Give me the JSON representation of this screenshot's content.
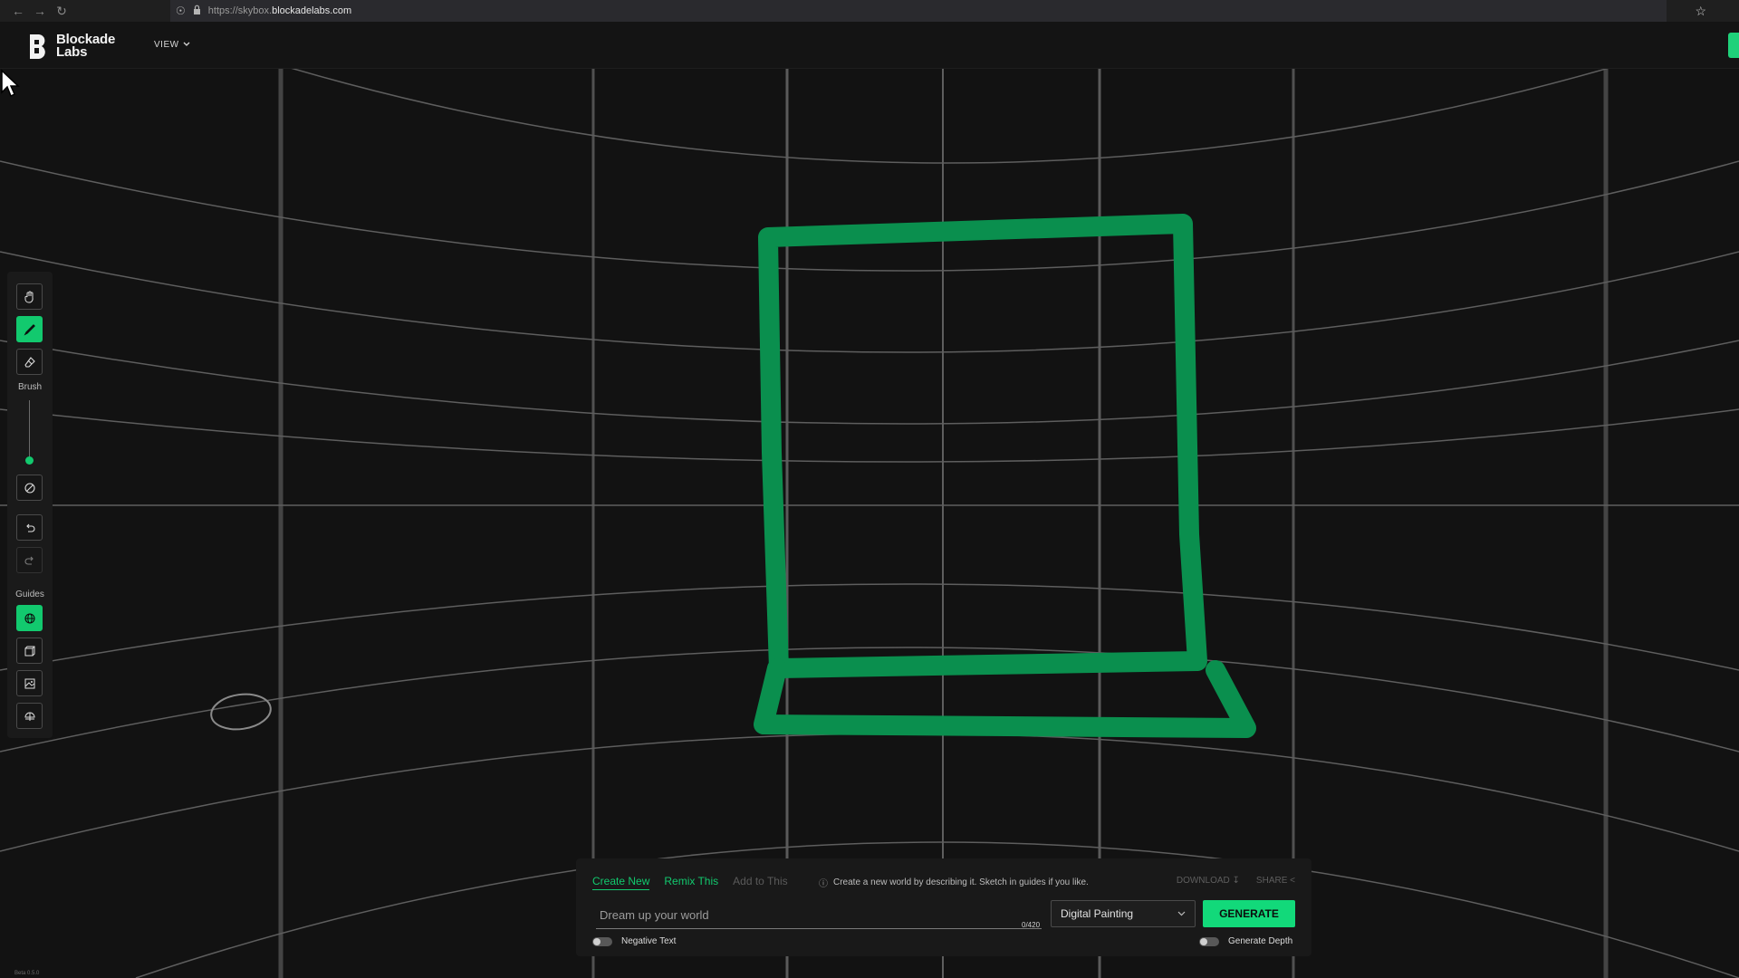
{
  "browser": {
    "url_prefix": "https://skybox.",
    "url_host": "blockadelabs.com"
  },
  "header": {
    "logo_text": "Blockade\nLabs",
    "view_label": "VIEW"
  },
  "tool_rail": {
    "brush_label": "Brush",
    "guides_label": "Guides",
    "tools": [
      "hand-icon",
      "brush-icon",
      "eraser-icon",
      "clear-icon",
      "undo-icon",
      "redo-icon",
      "globe-guide-icon",
      "cube-guide-icon",
      "image-guide-icon",
      "dome-guide-icon"
    ]
  },
  "prompt_panel": {
    "tabs": [
      "Create New",
      "Remix This",
      "Add to This"
    ],
    "hint": "Create a new world by describing it. Sketch in guides if you like.",
    "download_label": "DOWNLOAD",
    "share_label": "SHARE",
    "placeholder": "Dream up your world",
    "char_count": "0/420",
    "style_value": "Digital Painting",
    "generate_label": "GENERATE",
    "negative_text_label": "Negative Text",
    "generate_depth_label": "Generate Depth"
  },
  "version": "Beta 0.5.0",
  "colors": {
    "accent": "#12c96e",
    "sketch": "#0a8f4e",
    "background": "#121212"
  }
}
